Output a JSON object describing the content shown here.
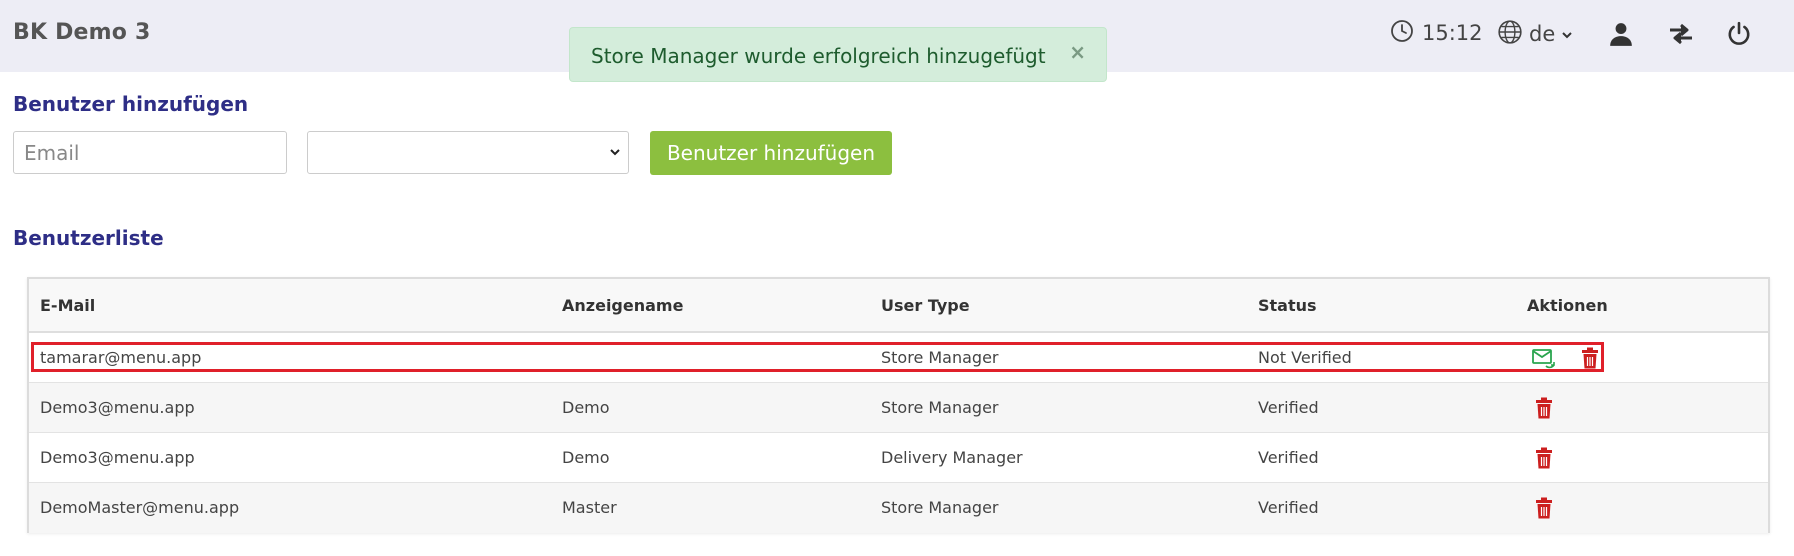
{
  "header": {
    "brand": "BK Demo 3",
    "time": "15:12",
    "language": "de",
    "icons": [
      "clock-icon",
      "globe-icon",
      "user-icon",
      "swap-icon",
      "power-icon"
    ]
  },
  "alert": {
    "message": "Store Manager wurde erfolgreich hinzugefügt",
    "close": "×"
  },
  "add_user": {
    "title": "Benutzer hinzufügen",
    "email_placeholder": "Email",
    "role_selected": "",
    "button_label": "Benutzer hinzufügen"
  },
  "user_list": {
    "title": "Benutzerliste",
    "columns": [
      "E-Mail",
      "Anzeigename",
      "User Type",
      "Status",
      "Aktionen"
    ],
    "rows": [
      {
        "email": "tamarar@menu.app",
        "name": "",
        "type": "Store Manager",
        "status": "Not Verified",
        "actions": [
          "resend-mail-icon",
          "trash-icon"
        ]
      },
      {
        "email": "Demo3@menu.app",
        "name": "Demo",
        "type": "Store Manager",
        "status": "Verified",
        "actions": [
          "trash-icon"
        ]
      },
      {
        "email": "Demo3@menu.app",
        "name": "Demo",
        "type": "Delivery Manager",
        "status": "Verified",
        "actions": [
          "trash-icon"
        ]
      },
      {
        "email": "DemoMaster@menu.app",
        "name": "Master",
        "type": "Store Manager",
        "status": "Verified",
        "actions": [
          "trash-icon"
        ]
      }
    ]
  },
  "colors": {
    "topbar": "#ededf5",
    "title": "#2e2e86",
    "button": "#8cbf3f",
    "alert_bg": "#d4eddb",
    "trash": "#cc1f1f",
    "mail": "#2aa54f",
    "highlight": "#e0202a"
  }
}
